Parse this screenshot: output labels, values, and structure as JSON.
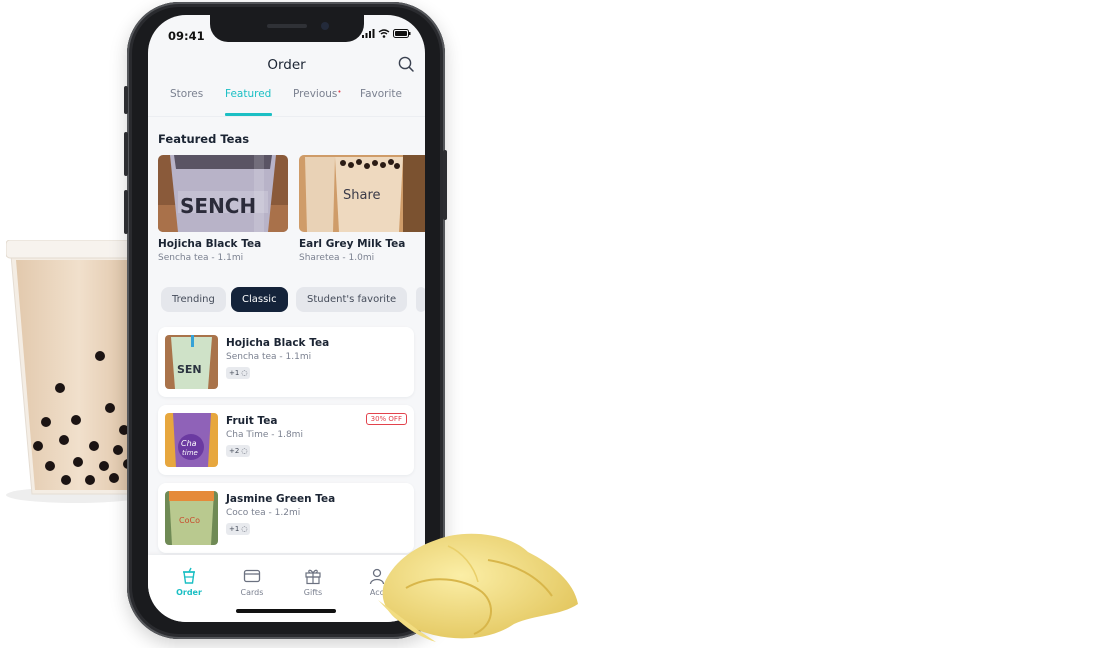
{
  "status_bar": {
    "time": "09:41"
  },
  "header": {
    "title": "Order"
  },
  "tabs": [
    {
      "label": "Stores",
      "active": false
    },
    {
      "label": "Featured",
      "active": true
    },
    {
      "label": "Previous",
      "active": false,
      "dot": "•"
    },
    {
      "label": "Favorite",
      "active": false
    }
  ],
  "featured": {
    "title": "Featured Teas",
    "items": [
      {
        "name": "Hojicha Black Tea",
        "subtitle": "Sencha tea - 1.1mi"
      },
      {
        "name": "Earl Grey Milk Tea",
        "subtitle": "Sharetea - 1.0mi"
      }
    ]
  },
  "filters": [
    {
      "label": "Trending",
      "active": false
    },
    {
      "label": "Classic",
      "active": true
    },
    {
      "label": "Student's favorite",
      "active": false
    }
  ],
  "drinks": [
    {
      "name": "Hojicha Black Tea",
      "subtitle": "Sencha tea - 1.1mi",
      "badge": "+1",
      "discount": ""
    },
    {
      "name": "Fruit Tea",
      "subtitle": "Cha Time - 1.8mi",
      "badge": "+2",
      "discount": "30% OFF"
    },
    {
      "name": "Jasmine Green Tea",
      "subtitle": "Coco tea - 1.2mi",
      "badge": "+1",
      "discount": ""
    }
  ],
  "bottom_nav": [
    {
      "label": "Order",
      "icon": "cup-icon",
      "active": true
    },
    {
      "label": "Cards",
      "icon": "card-icon",
      "active": false
    },
    {
      "label": "Gifts",
      "icon": "gift-icon",
      "active": false
    },
    {
      "label": "Acc",
      "icon": "person-icon",
      "active": false
    }
  ],
  "colors": {
    "accent": "#1bbfc4",
    "dark_chip": "#14233a",
    "discount_red": "#e2424c",
    "text_primary": "#1b2433",
    "text_secondary": "#7b8190"
  }
}
